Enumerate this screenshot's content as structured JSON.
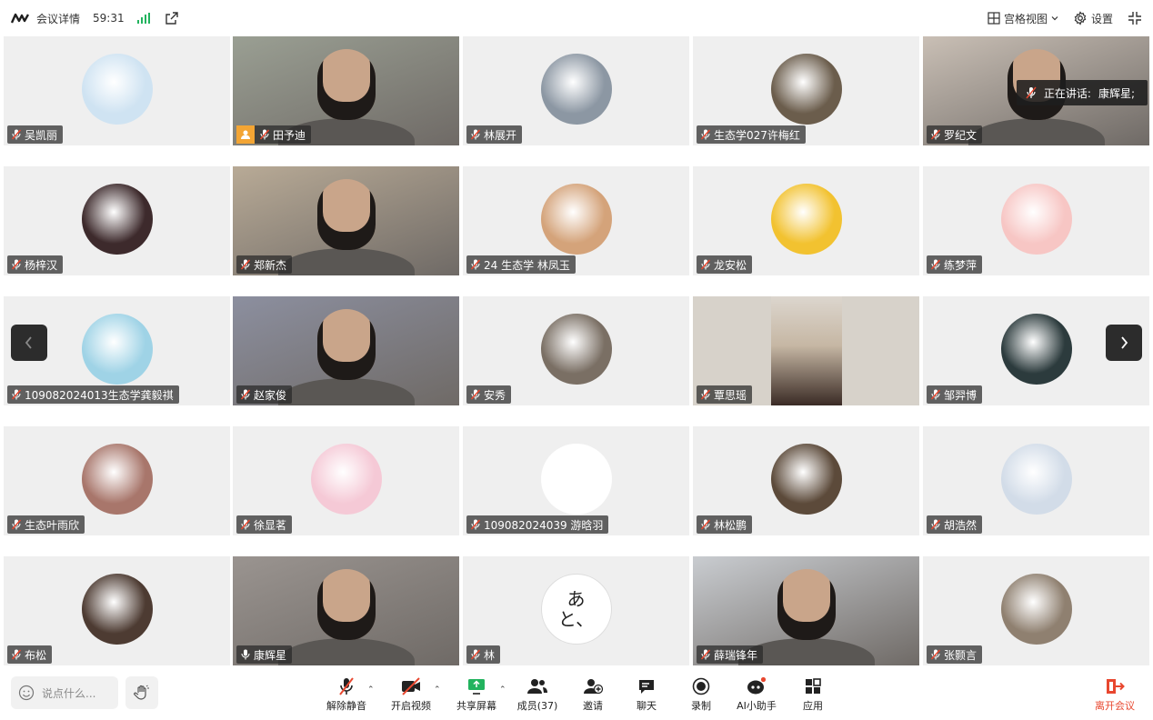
{
  "topbar": {
    "meeting_details": "会议详情",
    "timer": "59:31",
    "grid_view": "宫格视图",
    "settings": "设置"
  },
  "speaking": {
    "prefix": "正在讲话:",
    "name": "康辉星;"
  },
  "participants": [
    {
      "name": "吴凯丽",
      "kind": "avatar",
      "color": "#cfe3f2"
    },
    {
      "name": "田予迪",
      "kind": "video",
      "host": true,
      "color": "#9a9f93"
    },
    {
      "name": "林展开",
      "kind": "avatar",
      "color": "#8c97a3"
    },
    {
      "name": "生态学027许梅红",
      "kind": "avatar",
      "color": "#6b5d4c"
    },
    {
      "name": "罗纪文",
      "kind": "video",
      "color": "#c9bfb5"
    },
    {
      "name": "杨梓汉",
      "kind": "avatar",
      "color": "#3d2a2c"
    },
    {
      "name": "郑新杰",
      "kind": "video",
      "color": "#b8aa96"
    },
    {
      "name": "24 生态学 林凤玉",
      "kind": "avatar",
      "color": "#d4a37a"
    },
    {
      "name": "龙安松",
      "kind": "avatar",
      "color": "#f2c230"
    },
    {
      "name": "练梦萍",
      "kind": "avatar",
      "color": "#f7c6c4"
    },
    {
      "name": "109082024013生态学龚毅祺",
      "kind": "avatar",
      "color": "#9fd3e6"
    },
    {
      "name": "赵家俊",
      "kind": "video",
      "color": "#8c8f9f"
    },
    {
      "name": "安秀",
      "kind": "avatar",
      "color": "#7a6f64"
    },
    {
      "name": "覃思瑶",
      "kind": "video-narrow",
      "color": "#c6b7a4"
    },
    {
      "name": "邹羿博",
      "kind": "avatar",
      "color": "#2c3b3d"
    },
    {
      "name": "生态叶雨欣",
      "kind": "avatar",
      "color": "#a8766b"
    },
    {
      "name": "徐显茗",
      "kind": "avatar",
      "color": "#f5c9d6"
    },
    {
      "name": "109082024039 游晗羽",
      "kind": "avatar",
      "color": "#ffffff"
    },
    {
      "name": "林松鹏",
      "kind": "avatar",
      "color": "#5c4a3a"
    },
    {
      "name": "胡浩然",
      "kind": "avatar",
      "color": "#d2dce8"
    },
    {
      "name": "布松",
      "kind": "avatar",
      "color": "#4d3b32"
    },
    {
      "name": "康辉星",
      "kind": "video",
      "speaking": true,
      "color": "#9a9490"
    },
    {
      "name": "林",
      "kind": "avatar-text",
      "color": "#ffffff",
      "glyph": "あと、"
    },
    {
      "name": "薛瑞锋年",
      "kind": "video",
      "color": "#c9ccd0"
    },
    {
      "name": "张颢言",
      "kind": "avatar",
      "color": "#8f8070"
    }
  ],
  "bottombar": {
    "chat_placeholder": "说点什么...",
    "unmute": "解除静音",
    "start_video": "开启视频",
    "share_screen": "共享屏幕",
    "members": "成员(37)",
    "invite": "邀请",
    "chat": "聊天",
    "record": "录制",
    "ai_assistant": "AI小助手",
    "apps": "应用",
    "leave": "离开会议"
  },
  "colors": {
    "accent_green": "#22b35e",
    "speaking_border": "#3dbf7a",
    "leave_red": "#e8472f",
    "host_badge": "#f3a534"
  }
}
